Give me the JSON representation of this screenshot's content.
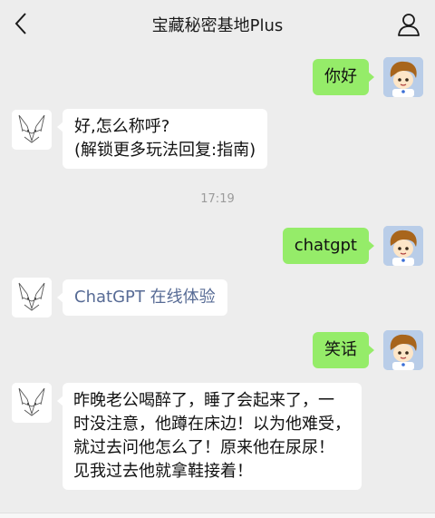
{
  "header": {
    "title": "宝藏秘密基地Plus",
    "back_icon": "chevron-left-icon",
    "profile_icon": "person-icon"
  },
  "messages": [
    {
      "side": "out",
      "text": "你好"
    },
    {
      "side": "in",
      "lines": [
        "好,怎么称呼?",
        "(解锁更多玩法回复:指南)"
      ]
    },
    {
      "timestamp": "17:19"
    },
    {
      "side": "out",
      "text": "chatgpt"
    },
    {
      "side": "in",
      "link": "ChatGPT 在线体验"
    },
    {
      "side": "out",
      "text": "笑话"
    },
    {
      "side": "in",
      "lines": [
        "昨晚老公喝醉了，睡了会起来了，一",
        "时没注意，他蹲在床边！以为他难受，",
        "就过去问他怎么了！原来他在尿尿！",
        "见我过去他就拿鞋接着！"
      ]
    }
  ],
  "colors": {
    "background": "#ededed",
    "outgoing_bubble": "#95ec69",
    "incoming_bubble": "#ffffff",
    "link": "#576b95"
  }
}
